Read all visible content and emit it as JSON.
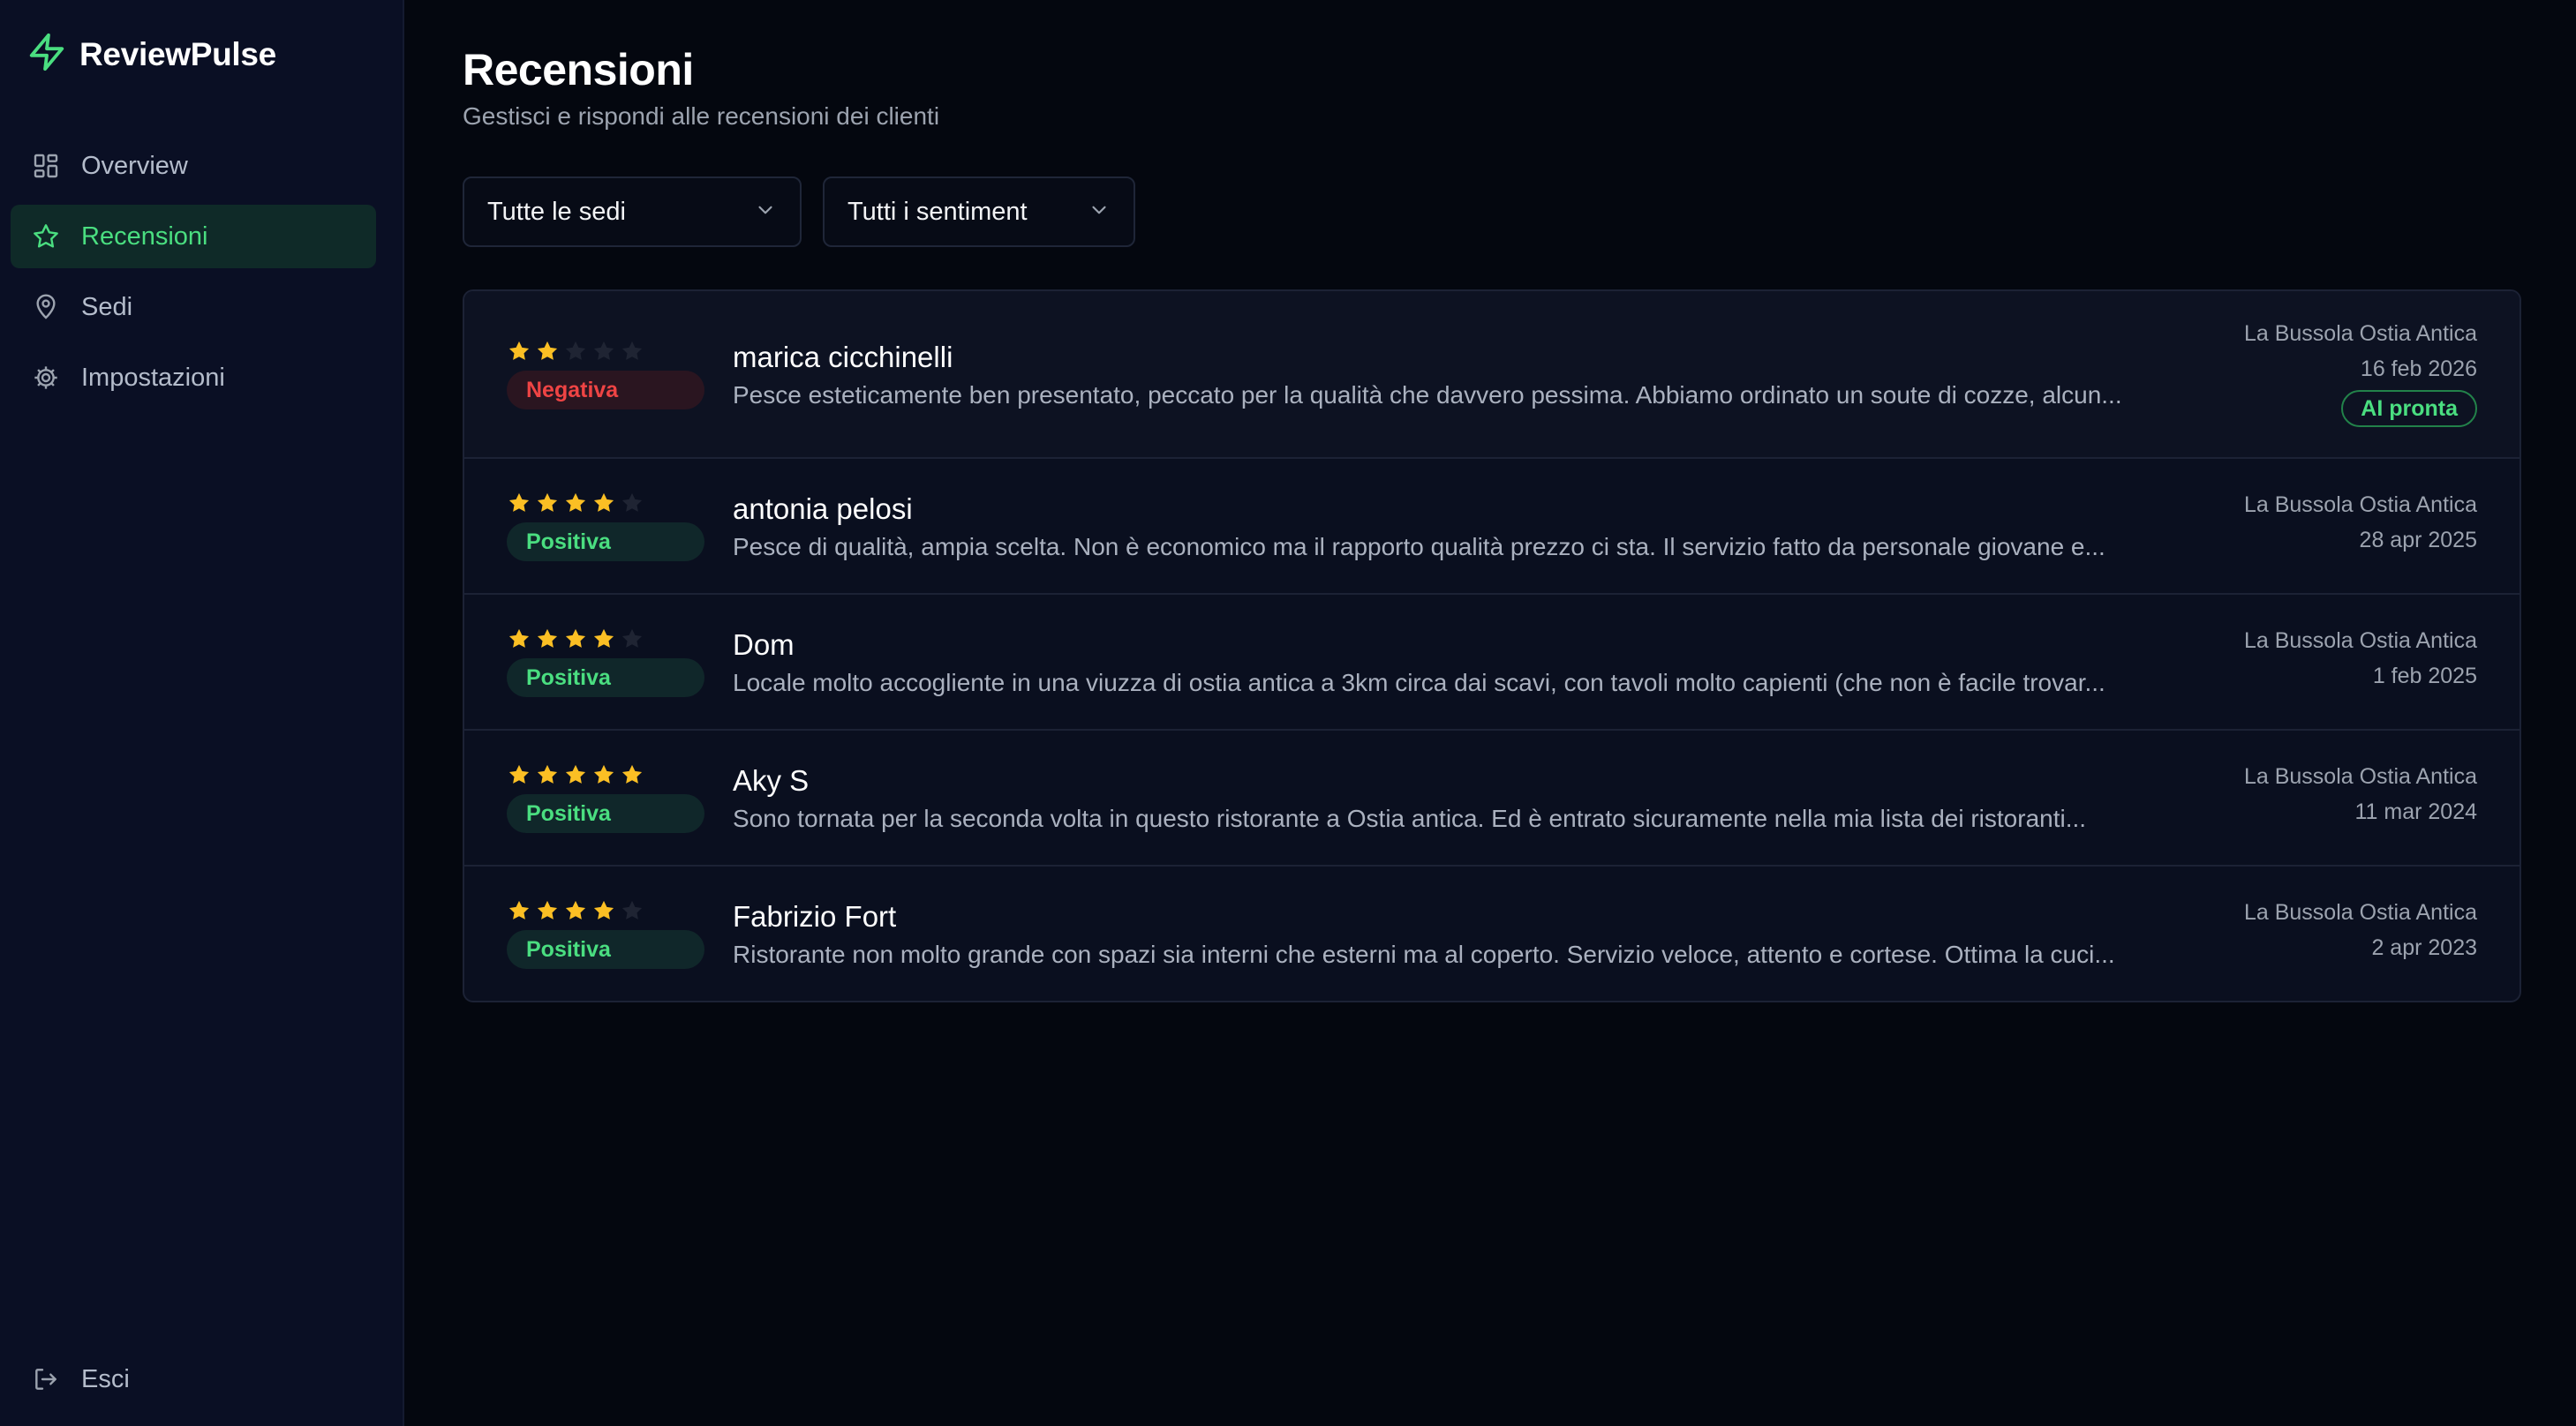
{
  "brand": {
    "name": "ReviewPulse",
    "icon": "lightning-icon",
    "accent": "#4ade80"
  },
  "sidebar": {
    "items": [
      {
        "label": "Overview",
        "icon": "dashboard-grid-icon",
        "active": false
      },
      {
        "label": "Recensioni",
        "icon": "star-icon",
        "active": true
      },
      {
        "label": "Sedi",
        "icon": "map-pin-icon",
        "active": false
      },
      {
        "label": "Impostazioni",
        "icon": "gear-icon",
        "active": false
      }
    ],
    "logout": {
      "label": "Esci",
      "icon": "logout-icon"
    }
  },
  "page": {
    "title": "Recensioni",
    "subtitle": "Gestisci e rispondi alle recensioni dei clienti"
  },
  "filters": {
    "location": {
      "value": "Tutte le sedi"
    },
    "sentiment": {
      "value": "Tutti i sentiment"
    }
  },
  "reviews": [
    {
      "rating": 2,
      "sentiment": "Negativa",
      "author": "marica cicchinelli",
      "text": "Pesce esteticamente ben presentato, peccato per la qualità che davvero pessima. Abbiamo ordinato un soute di cozze, alcun...",
      "location": "La Bussola Ostia Antica",
      "date": "16 feb 2026",
      "ai_badge": "AI pronta"
    },
    {
      "rating": 4,
      "sentiment": "Positiva",
      "author": "antonia pelosi",
      "text": "Pesce di qualità, ampia scelta. Non è economico ma il rapporto qualità prezzo ci sta. Il servizio fatto da personale giovane e...",
      "location": "La Bussola Ostia Antica",
      "date": "28 apr 2025"
    },
    {
      "rating": 4,
      "sentiment": "Positiva",
      "author": "Dom",
      "text": "Locale molto accogliente in una viuzza di ostia antica a 3km circa dai scavi, con tavoli molto capienti (che non è facile trovar...",
      "location": "La Bussola Ostia Antica",
      "date": "1 feb 2025"
    },
    {
      "rating": 5,
      "sentiment": "Positiva",
      "author": "Aky S",
      "text": "Sono tornata per la seconda volta in questo ristorante a Ostia antica. Ed è entrato sicuramente nella mia lista dei ristoranti...",
      "location": "La Bussola Ostia Antica",
      "date": "11 mar 2024"
    },
    {
      "rating": 4,
      "sentiment": "Positiva",
      "author": "Fabrizio Fort",
      "text": "Ristorante non molto grande con spazi sia interni che esterni ma al coperto. Servizio veloce, attento e cortese. Ottima la cuci...",
      "location": "La Bussola Ostia Antica",
      "date": "2 apr 2023"
    }
  ]
}
